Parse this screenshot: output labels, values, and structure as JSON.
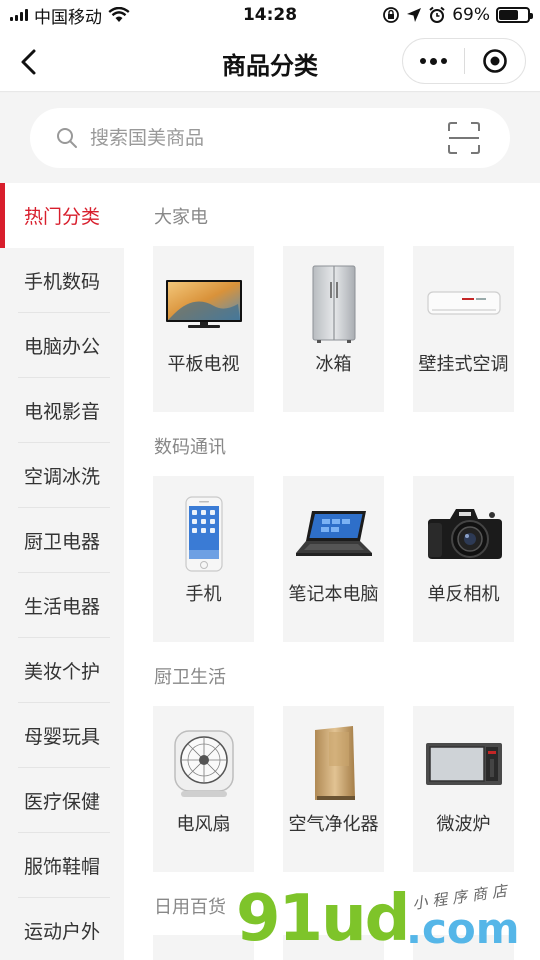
{
  "status_bar": {
    "carrier": "中国移动",
    "time": "14:28",
    "battery": "69%",
    "battery_level": 0.69
  },
  "nav": {
    "title": "商品分类"
  },
  "search": {
    "placeholder": "搜索国美商品"
  },
  "sidebar": {
    "items": [
      {
        "label": "热门分类",
        "active": true
      },
      {
        "label": "手机数码"
      },
      {
        "label": "电脑办公"
      },
      {
        "label": "电视影音"
      },
      {
        "label": "空调冰洗"
      },
      {
        "label": "厨卫电器"
      },
      {
        "label": "生活电器"
      },
      {
        "label": "美妆个护"
      },
      {
        "label": "母婴玩具"
      },
      {
        "label": "医疗保健"
      },
      {
        "label": "服饰鞋帽"
      },
      {
        "label": "运动户外"
      }
    ]
  },
  "sections": [
    {
      "title": "大家电",
      "items": [
        {
          "name": "平板电视",
          "icon": "tv-icon"
        },
        {
          "name": "冰箱",
          "icon": "refrigerator-icon"
        },
        {
          "name": "壁挂式空调",
          "icon": "air-conditioner-icon"
        }
      ]
    },
    {
      "title": "数码通讯",
      "items": [
        {
          "name": "手机",
          "icon": "phone-icon"
        },
        {
          "name": "笔记本电脑",
          "icon": "laptop-icon"
        },
        {
          "name": "单反相机",
          "icon": "camera-icon"
        }
      ]
    },
    {
      "title": "厨卫生活",
      "items": [
        {
          "name": "电风扇",
          "icon": "fan-icon"
        },
        {
          "name": "空气净化器",
          "icon": "air-purifier-icon"
        },
        {
          "name": "微波炉",
          "icon": "microwave-icon"
        }
      ]
    },
    {
      "title": "日用百货",
      "items": []
    }
  ],
  "watermark": {
    "logo": "91ud",
    "suffix": ".com",
    "tagline": "小程序商店"
  },
  "colors": {
    "accent": "#d81e2c",
    "watermark_green": "#7ec42a",
    "watermark_blue": "#55b6e8"
  }
}
